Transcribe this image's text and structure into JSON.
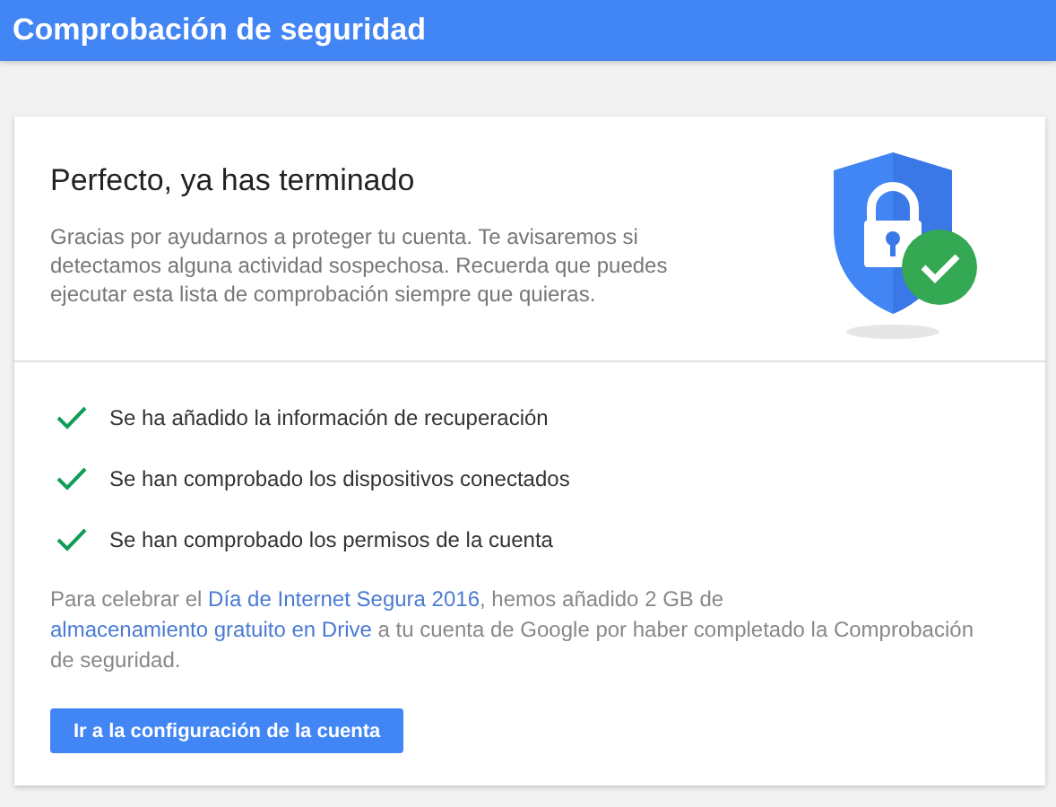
{
  "app_bar": {
    "title": "Comprobación de seguridad"
  },
  "card": {
    "heading": "Perfecto, ya has terminado",
    "description": "Gracias por ayudarnos a proteger tu cuenta. Te avisaremos si detectamos alguna actividad sospechosa. Recuerda que puedes ejecutar esta lista de comprobación siempre que quieras.",
    "checklist": [
      {
        "label": "Se ha añadido la información de recuperación"
      },
      {
        "label": "Se han comprobado los dispositivos conectados"
      },
      {
        "label": "Se han comprobado los permisos de la cuenta"
      }
    ],
    "note": [
      {
        "kind": "text",
        "text": "Para celebrar el "
      },
      {
        "kind": "link",
        "text": "Día de Internet Segura 2016"
      },
      {
        "kind": "text",
        "text": ", hemos añadido 2 GB de "
      },
      {
        "kind": "link",
        "text": "almacenamiento gratuito en Drive"
      },
      {
        "kind": "text",
        "text": " a tu cuenta de Google por haber completado la Comprobación de seguridad."
      }
    ],
    "button": "Ir a la configuración de la cuenta"
  }
}
